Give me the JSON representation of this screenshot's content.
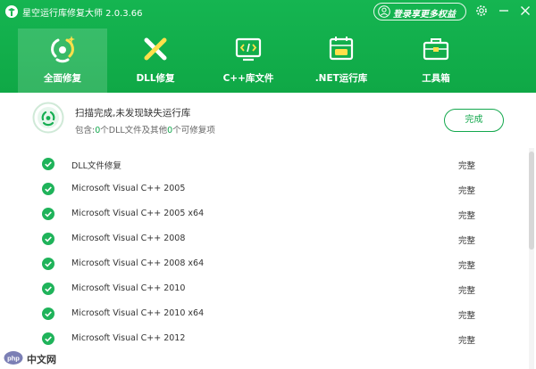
{
  "app": {
    "title": "星空运行库修复大师 2.0.3.66",
    "login_label": "登录享更多权益"
  },
  "tabs": [
    {
      "label": "全面修复",
      "icon": "full-repair-icon",
      "active": true
    },
    {
      "label": "DLL修复",
      "icon": "dll-repair-icon",
      "active": false
    },
    {
      "label": "C++库文件",
      "icon": "cpp-code-icon",
      "active": false
    },
    {
      "label": ".NET运行库",
      "icon": "dotnet-icon",
      "active": false
    },
    {
      "label": "工具箱",
      "icon": "toolbox-icon",
      "active": false
    }
  ],
  "status": {
    "title": "扫描完成,未发现缺失运行库",
    "detail_prefix": "包含:",
    "dll_count": "0",
    "detail_middle": "个DLL文件及其他",
    "other_count": "0",
    "detail_suffix": "个可修复项",
    "done_label": "完成"
  },
  "items": [
    {
      "name": "DLL文件修复",
      "status": "完整"
    },
    {
      "name": "Microsoft Visual C++ 2005",
      "status": "完整"
    },
    {
      "name": "Microsoft Visual C++ 2005 x64",
      "status": "完整"
    },
    {
      "name": "Microsoft Visual C++ 2008",
      "status": "完整"
    },
    {
      "name": "Microsoft Visual C++ 2008 x64",
      "status": "完整"
    },
    {
      "name": "Microsoft Visual C++ 2010",
      "status": "完整"
    },
    {
      "name": "Microsoft Visual C++ 2010 x64",
      "status": "完整"
    },
    {
      "name": "Microsoft Visual C++ 2012",
      "status": "完整"
    }
  ],
  "watermark": {
    "text": "中文网"
  },
  "colors": {
    "header_green": "#15b551",
    "accent_green": "#13a84d",
    "check_green": "#1fb35a"
  }
}
